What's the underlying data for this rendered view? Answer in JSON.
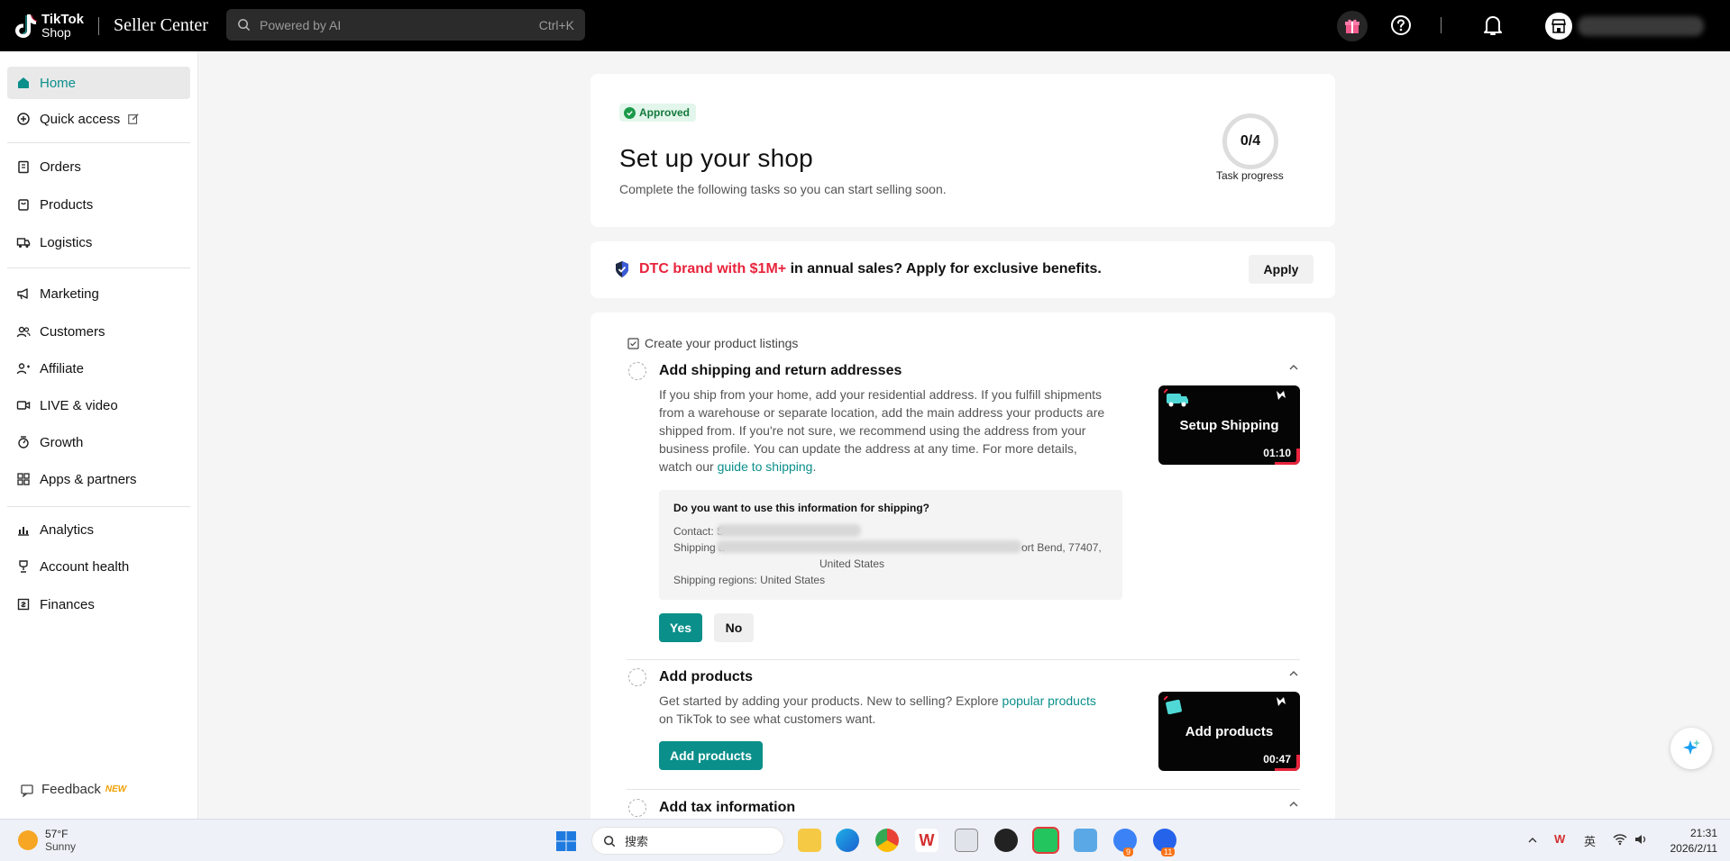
{
  "topbar": {
    "logo_line1": "TikTok",
    "logo_line2": "Shop",
    "product_name": "Seller Center",
    "search_placeholder": "Powered by AI",
    "search_shortcut": "Ctrl+K"
  },
  "sidebar": {
    "items": [
      {
        "label": "Home",
        "icon": "home-icon",
        "active": true
      },
      {
        "label": "Quick access",
        "icon": "plus-circle-icon"
      },
      {
        "label": "Orders",
        "icon": "clipboard-icon"
      },
      {
        "label": "Products",
        "icon": "box-icon"
      },
      {
        "label": "Logistics",
        "icon": "truck-icon"
      },
      {
        "label": "Marketing",
        "icon": "megaphone-icon"
      },
      {
        "label": "Customers",
        "icon": "users-icon"
      },
      {
        "label": "Affiliate",
        "icon": "affiliate-icon"
      },
      {
        "label": "LIVE & video",
        "icon": "video-icon"
      },
      {
        "label": "Growth",
        "icon": "growth-icon"
      },
      {
        "label": "Apps & partners",
        "icon": "apps-icon"
      },
      {
        "label": "Analytics",
        "icon": "chart-icon"
      },
      {
        "label": "Account health",
        "icon": "trophy-icon"
      },
      {
        "label": "Finances",
        "icon": "finance-icon"
      }
    ],
    "feedback_label": "Feedback",
    "feedback_badge": "NEW"
  },
  "setup": {
    "status": "Approved",
    "title": "Set up your shop",
    "subtitle": "Complete the following tasks so you can start selling soon.",
    "progress_value": "0/4",
    "progress_fraction": 0,
    "progress_label": "Task progress"
  },
  "banner": {
    "highlight": "DTC brand with $1M+",
    "rest": " in annual sales? Apply for exclusive benefits.",
    "apply_label": "Apply"
  },
  "tasks": {
    "section_label": "Create your product listings",
    "shipping": {
      "title": "Add shipping and return addresses",
      "desc_lines": [
        "If you ship from your home, add your residential address. If you fulfill shipments",
        "from a warehouse or separate location, add the main address your products are",
        "shipped from. If you're not sure, we recommend using the address from your",
        "business profile. You can update the address at any time. For more details,"
      ],
      "desc_last_prefix": "watch our ",
      "desc_link": "guide to shipping",
      "desc_last_suffix": ".",
      "video_title": "Setup Shipping",
      "video_duration": "01:10",
      "question": "Do you want to use this information for shipping?",
      "contact_label": "Contact: S",
      "shipping_label": "Shipping a",
      "address_tail": "ort Bend, 77407,",
      "country": "United States",
      "regions": "Shipping regions: United States",
      "yes_label": "Yes",
      "no_label": "No"
    },
    "products": {
      "title": "Add products",
      "desc_prefix": "Get started by adding your products. New to selling? Explore ",
      "desc_link": "popular products",
      "desc_line2": "on TikTok to see what customers want.",
      "button_label": "Add products",
      "video_title": "Add products",
      "video_duration": "00:47"
    },
    "tax": {
      "title": "Add tax information"
    }
  },
  "taskbar": {
    "temperature": "57°F",
    "weather": "Sunny",
    "search_placeholder": "搜索",
    "ime": "英",
    "time": "21:31",
    "date": "2026/2/11",
    "badge_a": "9",
    "badge_b": "11"
  },
  "colors": {
    "accent": "#0a8f8a",
    "brand_red": "#e8243c",
    "approved_green": "#1a9a4a"
  }
}
